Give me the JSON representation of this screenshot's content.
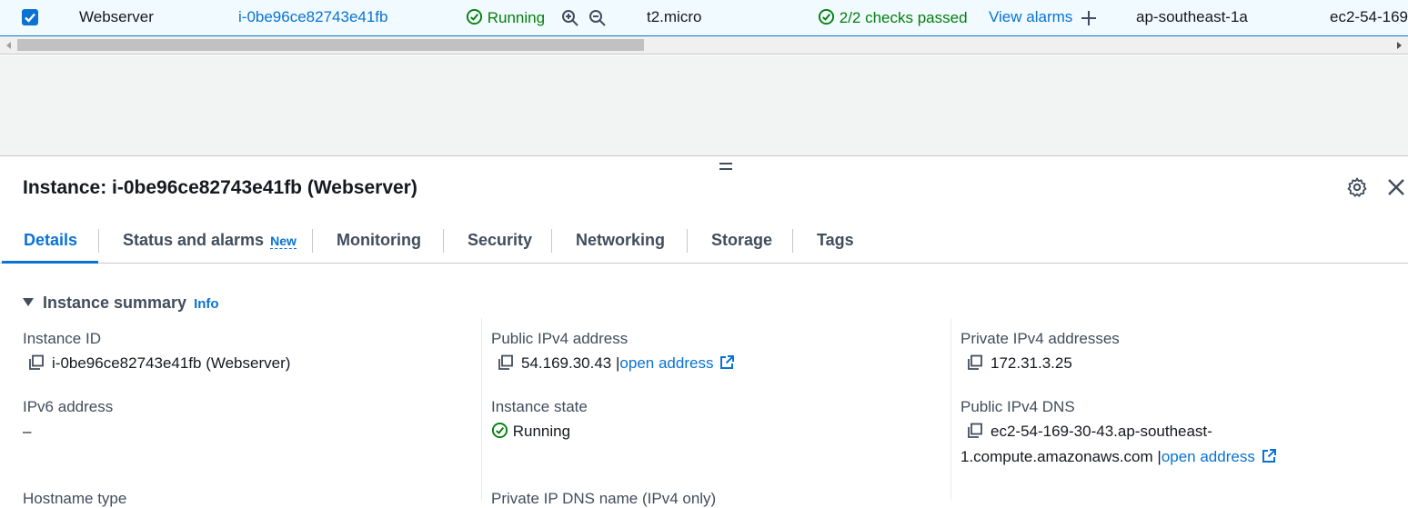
{
  "row": {
    "name": "Webserver",
    "instance_id": "i-0be96ce82743e41fb",
    "state": "Running",
    "type": "t2.micro",
    "checks": "2/2 checks passed",
    "alarms_link": "View alarms",
    "az": "ap-southeast-1a",
    "dns_truncated": "ec2-54-169"
  },
  "panel": {
    "title": "Instance: i-0be96ce82743e41fb (Webserver)",
    "tabs": [
      {
        "label": "Details"
      },
      {
        "label": "Status and alarms",
        "badge": "New"
      },
      {
        "label": "Monitoring"
      },
      {
        "label": "Security"
      },
      {
        "label": "Networking"
      },
      {
        "label": "Storage"
      },
      {
        "label": "Tags"
      }
    ],
    "section": {
      "title": "Instance summary",
      "info": "Info"
    },
    "fields": {
      "instance_id_label": "Instance ID",
      "instance_id_value": "i-0be96ce82743e41fb (Webserver)",
      "ipv6_label": "IPv6 address",
      "ipv6_value": "–",
      "hostname_label": "Hostname type",
      "public_ipv4_label": "Public IPv4 address",
      "public_ipv4_value": "54.169.30.43",
      "public_ipv4_sep": "|",
      "open_address": "open address",
      "instance_state_label": "Instance state",
      "instance_state_value": "Running",
      "private_dns_label": "Private IP DNS name (IPv4 only)",
      "private_ipv4_label": "Private IPv4 addresses",
      "private_ipv4_value": "172.31.3.25",
      "public_dns_label": "Public IPv4 DNS",
      "public_dns_value_line1": "ec2-54-169-30-43.ap-southeast-",
      "public_dns_value_line2": "1.compute.amazonaws.com",
      "public_dns_sep": "|",
      "public_dns_open": "open address"
    }
  },
  "colors": {
    "link": "#0972d3",
    "success": "#037f0c",
    "selected_row_bg": "#f1faff"
  }
}
